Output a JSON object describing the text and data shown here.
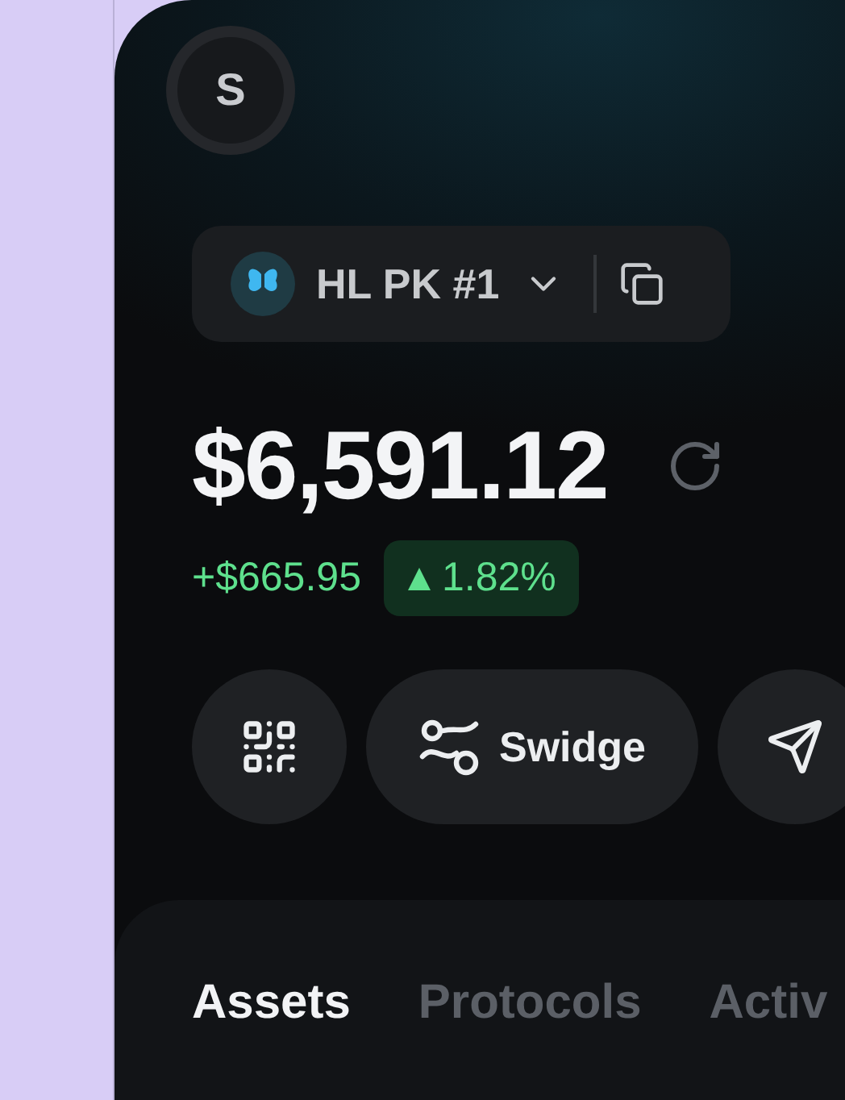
{
  "avatar": {
    "initial": "S"
  },
  "account": {
    "name": "HL PK #1"
  },
  "balance": {
    "amount": "$6,591.12"
  },
  "change": {
    "amount": "+$665.95",
    "percent": "1.82%",
    "rising": true
  },
  "actions": [
    {
      "kind": "qr"
    },
    {
      "kind": "swidge",
      "label": "Swidge"
    },
    {
      "kind": "send"
    }
  ],
  "tabs": [
    {
      "label": "Assets",
      "selected": true
    },
    {
      "label": "Protocols",
      "selected": false
    },
    {
      "label": "Activ",
      "selected": false
    }
  ]
}
